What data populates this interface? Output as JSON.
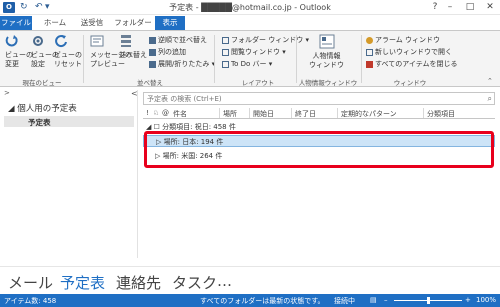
{
  "window": {
    "title": "予定表 - ",
    "email_masked": "█████@hotmail.co.jp - Outlook",
    "min": "–",
    "restore": "□",
    "close": "✕",
    "help": "?"
  },
  "qat": {
    "undo": "↶",
    "more": "▾"
  },
  "tabs": {
    "file": "ファイル",
    "home": "ホーム",
    "send": "送受信",
    "folder": "フォルダー",
    "view": "表示"
  },
  "ribbon": {
    "view_change": "ビューの\n変更",
    "view_settings": "ビューの\n設定",
    "view_reset": "ビューの\nリセット",
    "group_current_view": "現在のビュー",
    "message_preview": "メッセージの\nプレビュー",
    "sort": "並べ替え",
    "reverse_sort": "逆順で並べ替え",
    "add_column": "列の追加",
    "expand_collapse": "展開/折りたたみ",
    "group_arrange": "並べ替え",
    "folder_pane": "フォルダー ウィンドウ",
    "reading_pane": "閲覧ウィンドウ",
    "todo_bar": "To Do バー",
    "group_layout": "レイアウト",
    "people_pane": "人物情報\nウィンドウ",
    "group_people": "人物情報ウィンドウ",
    "alarm_window": "アラーム ウィンドウ",
    "open_new_window": "新しいウィンドウで開く",
    "close_all": "すべてのアイテムを閉じる",
    "group_window": "ウィンドウ",
    "dropdown": "▾"
  },
  "nav_pane": {
    "expand_icon": ">",
    "collapse_icon": "<",
    "section": "◢ 個人用の予定表",
    "item": "予定表"
  },
  "search": {
    "placeholder": "予定表 の検索 (Ctrl+E)",
    "icon": "⌕"
  },
  "columns": [
    "!",
    "♘",
    "@",
    "件名",
    "場所",
    "開始日",
    "終了日",
    "定期的なパターン",
    "分類項目"
  ],
  "group_header": "◢ ☐ 分類項目: 祝日: 458 件",
  "rows": [
    {
      "label": "▷ 場所: 日本: 194 件"
    },
    {
      "label": "▷ 場所: 米国: 264 件"
    }
  ],
  "bottom_nav": {
    "mail": "メール",
    "calendar": "予定表",
    "people": "連絡先",
    "tasks": "タスク",
    "more": "…"
  },
  "status": {
    "items": "アイテム数: 458",
    "folders_up_to_date": "すべてのフォルダーは最新の状態です。",
    "connection": "接続中",
    "zoom": "100%",
    "zoom_minus": "–",
    "zoom_plus": "+"
  },
  "colors": {
    "accent": "#1f6fc4",
    "highlight": "#e8001c",
    "selected_row": "#cde4f7"
  }
}
